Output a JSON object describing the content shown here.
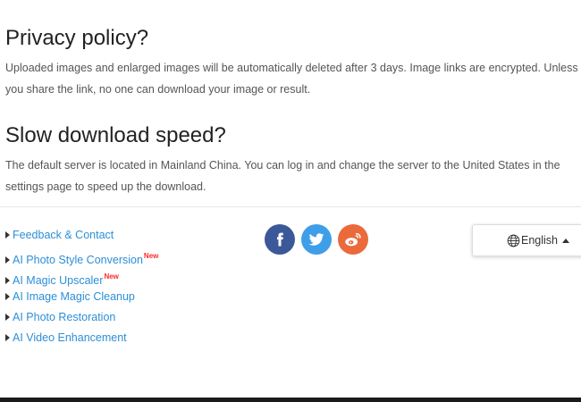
{
  "faq": [
    {
      "title": "Privacy policy?",
      "body": "Uploaded images and enlarged images will be automatically deleted after 3 days. Image links are encrypted. Unless you share the link, no one can download your image or result."
    },
    {
      "title": "Slow download speed?",
      "body": "The default server is located in Mainland China. You can log in and change the server to the United States in the settings page to speed up the download."
    }
  ],
  "footer": {
    "links": [
      {
        "label": "Feedback & Contact",
        "badge": ""
      },
      {
        "label": "AI Photo Style Conversion",
        "badge": "New"
      },
      {
        "label": "AI Magic Upscaler",
        "badge": "New"
      },
      {
        "label": "AI Image Magic Cleanup",
        "badge": ""
      },
      {
        "label": "AI Photo Restoration",
        "badge": ""
      },
      {
        "label": "AI Video Enhancement",
        "badge": ""
      }
    ],
    "social": {
      "icons": [
        "facebook-icon",
        "twitter-icon",
        "weibo-icon"
      ],
      "colors": {
        "facebook": "#3b5998",
        "twitter": "#3f9ee8",
        "weibo": "#ea6a3c"
      }
    },
    "language": {
      "label": "English",
      "icon": "globe-icon"
    }
  },
  "colors": {
    "link": "#2c8fd6",
    "badge": "#ff2a2a",
    "text": "#555555",
    "heading": "#222222"
  }
}
